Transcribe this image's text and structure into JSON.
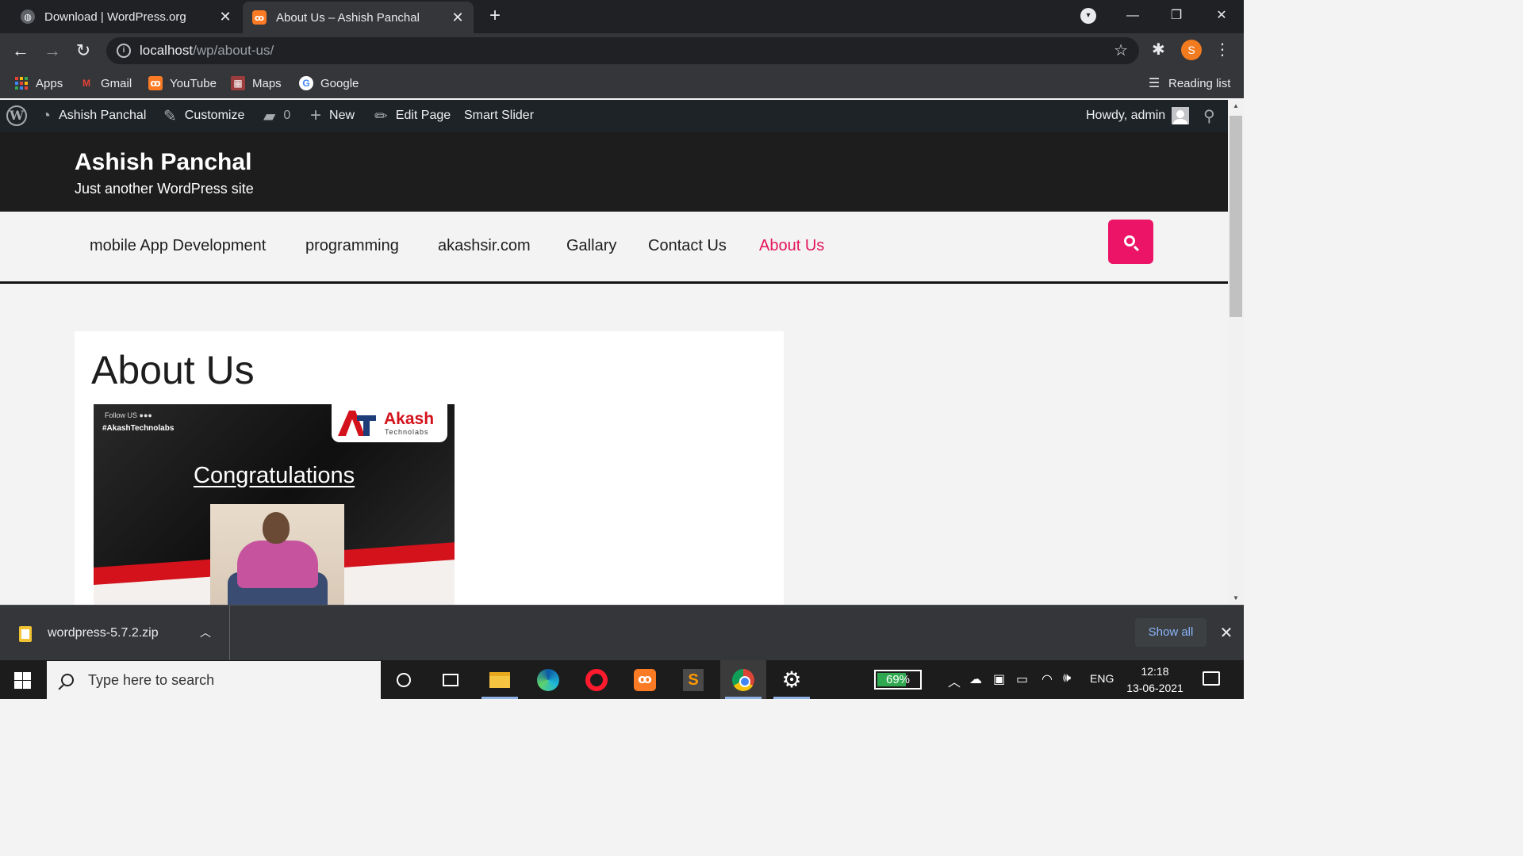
{
  "browser": {
    "tabs": [
      {
        "title": "Download | WordPress.org",
        "active": false
      },
      {
        "title": "About Us – Ashish Panchal",
        "active": true
      }
    ],
    "new_tab_glyph": "+",
    "close_glyph": "✕",
    "url_host": "localhost",
    "url_path": "/wp/about-us/",
    "profile_initial": "S",
    "bookmarks": [
      {
        "label": "Apps",
        "icon": "apps-grid-icon"
      },
      {
        "label": "Gmail",
        "icon": "gmail-icon"
      },
      {
        "label": "YouTube",
        "icon": "xampp-icon"
      },
      {
        "label": "Maps",
        "icon": "maps-icon"
      },
      {
        "label": "Google",
        "icon": "google-icon"
      }
    ],
    "reading_list": "Reading list"
  },
  "adminbar": {
    "site_name": "Ashish Panchal",
    "customize": "Customize",
    "comments_count": "0",
    "new": "New",
    "edit_page": "Edit Page",
    "smart_slider": "Smart Slider",
    "howdy": "Howdy, admin"
  },
  "site": {
    "title": "Ashish Panchal",
    "description": "Just another WordPress site",
    "accent_color": "#e4145a",
    "nav": [
      {
        "label": "mobile App Development",
        "current": false
      },
      {
        "label": "programming",
        "current": false
      },
      {
        "label": "akashsir.com",
        "current": false
      },
      {
        "label": "Gallary",
        "current": false
      },
      {
        "label": "Contact Us",
        "current": false
      },
      {
        "label": "About Us",
        "current": true
      }
    ]
  },
  "page": {
    "title": "About Us",
    "banner": {
      "follow": "Follow US",
      "hashtag": "#AkashTechnolabs",
      "logo_name": "Akash",
      "logo_sub": "Technolabs",
      "headline": "Congratulations"
    }
  },
  "downloads": {
    "file": "wordpress-5.7.2.zip",
    "show_all": "Show all"
  },
  "taskbar": {
    "search_placeholder": "Type here to search",
    "battery": "69%",
    "battery_level": 0.69,
    "language": "ENG",
    "time": "12:18",
    "date": "13-06-2021"
  }
}
